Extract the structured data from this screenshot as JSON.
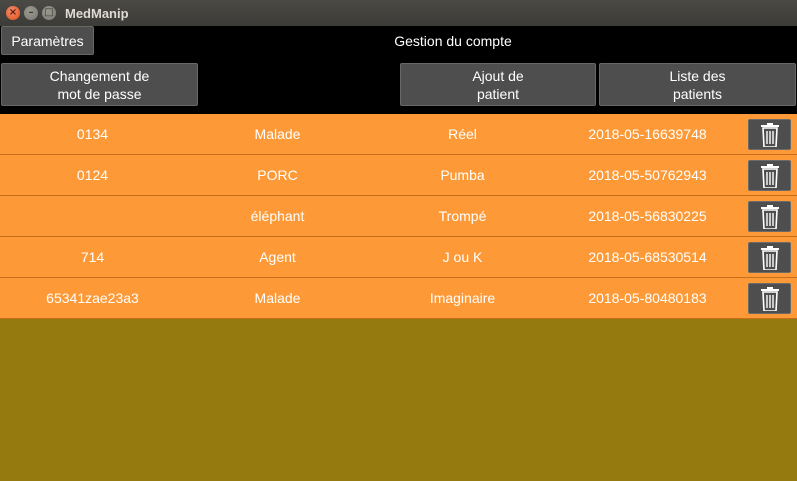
{
  "window": {
    "title": "MedManip"
  },
  "header": {
    "params_label": "Paramètres",
    "title": "Gestion du compte"
  },
  "actions": {
    "change_password": "Changement de\nmot de passe",
    "add_patient": "Ajout de\npatient",
    "patient_list": "Liste des\npatients"
  },
  "patients": [
    {
      "id": "0134",
      "type": "Malade",
      "name": "Réel",
      "date": "2018-05-16639748"
    },
    {
      "id": "0124",
      "type": "PORC",
      "name": "Pumba",
      "date": "2018-05-50762943"
    },
    {
      "id": "",
      "type": "éléphant",
      "name": "Trompé",
      "date": "2018-05-56830225"
    },
    {
      "id": "714",
      "type": "Agent",
      "name": "J ou K",
      "date": "2018-05-68530514"
    },
    {
      "id": "65341zae23a3",
      "type": "Malade",
      "name": "Imaginaire",
      "date": "2018-05-80480183"
    }
  ],
  "icons": {
    "delete": "trash-icon"
  },
  "colors": {
    "row_bg": "#fd9a37",
    "filler_bg": "#957a10",
    "button_bg": "#4e4e4e"
  }
}
